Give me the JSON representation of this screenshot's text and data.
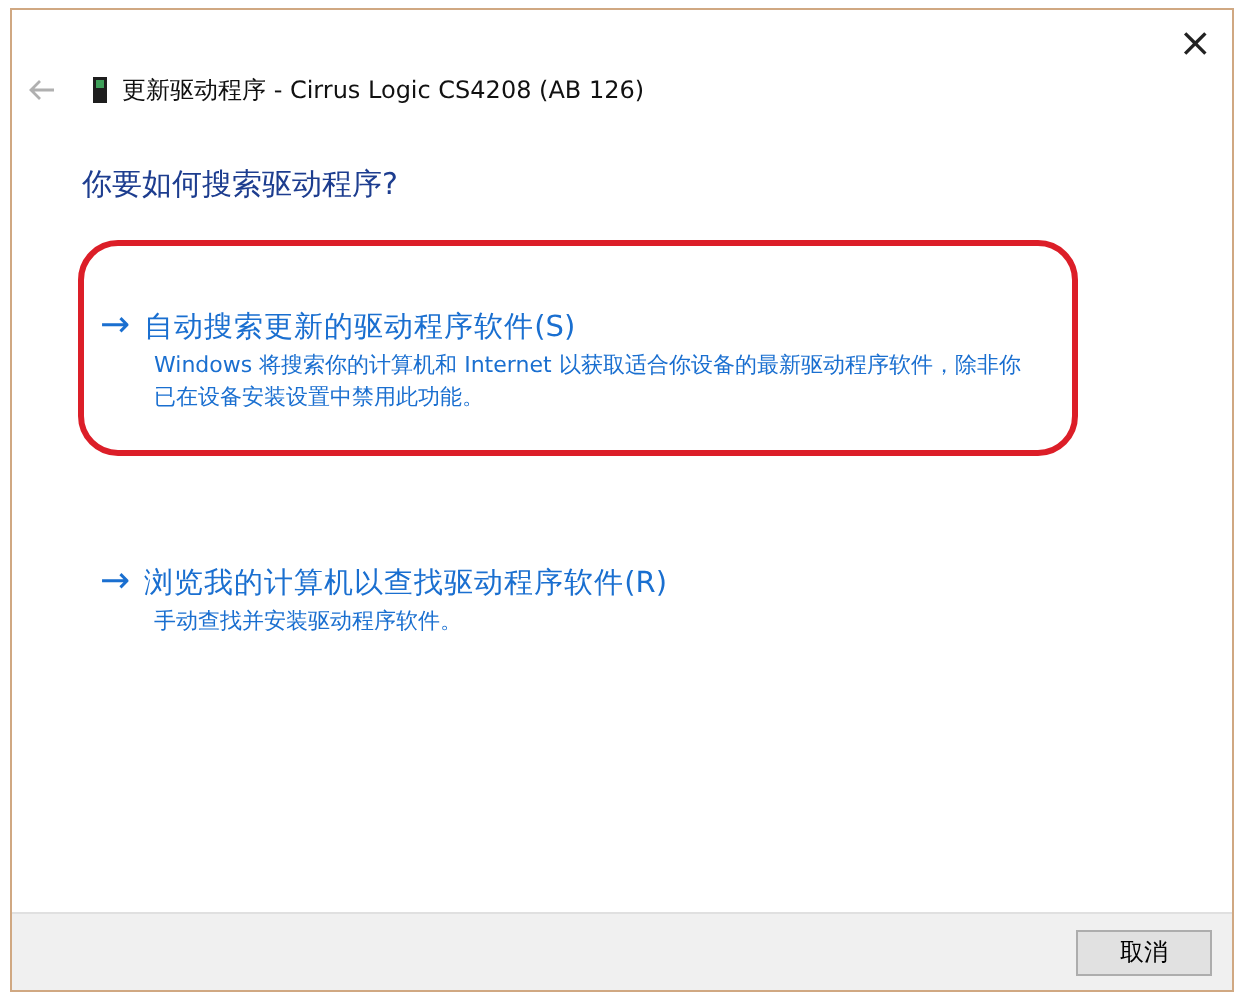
{
  "window": {
    "title": "更新驱动程序 - Cirrus Logic CS4208 (AB 126)",
    "close": "×"
  },
  "heading": "你要如何搜索驱动程序?",
  "options": [
    {
      "arrow": "→",
      "title": "自动搜索更新的驱动程序软件(S)",
      "description": "Windows 将搜索你的计算机和 Internet 以获取适合你设备的最新驱动程序软件，除非你已在设备安装设置中禁用此功能。",
      "highlighted": true
    },
    {
      "arrow": "→",
      "title": "浏览我的计算机以查找驱动程序软件(R)",
      "description": "手动查找并安装驱动程序软件。",
      "highlighted": false
    }
  ],
  "buttons": [
    "取消"
  ]
}
